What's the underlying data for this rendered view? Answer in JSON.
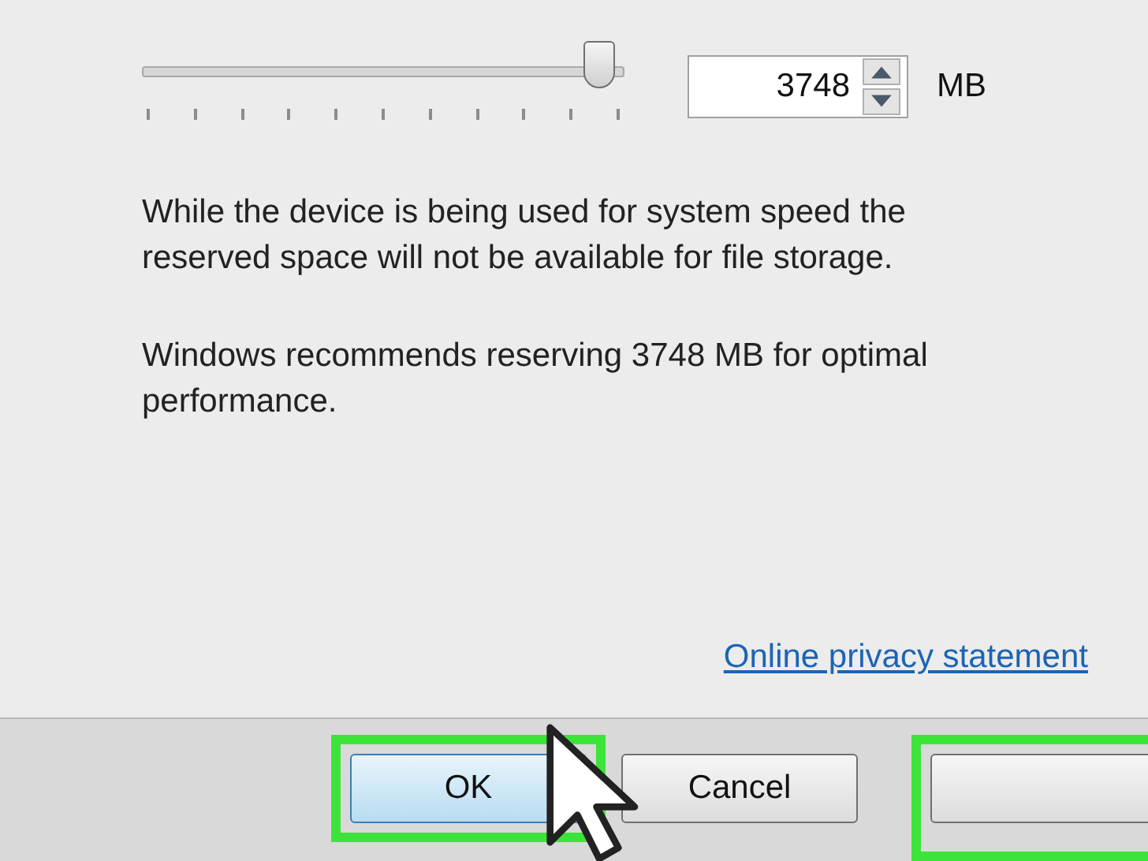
{
  "slider": {
    "level": 0.95
  },
  "spinbox": {
    "value": "3748"
  },
  "unit": "MB",
  "paragraphs": [
    "While the device is being used for system speed the reserved space will not be available for file storage.",
    "Windows recommends reserving 3748 MB for optimal performance."
  ],
  "link": "Online privacy statement",
  "buttons": [
    {
      "label": "OK",
      "default": true,
      "highlighted": true
    },
    {
      "label": "Cancel",
      "default": false,
      "highlighted": false
    }
  ],
  "third_button_highlighted": true
}
